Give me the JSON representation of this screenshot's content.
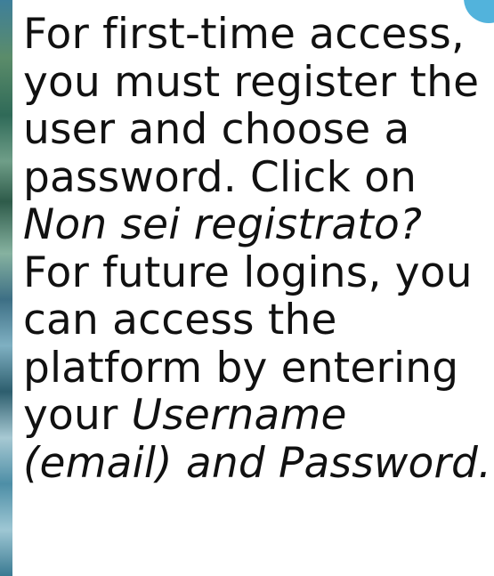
{
  "instructions": {
    "line1": "For first-time access,",
    "line2": "you must register the",
    "line3": "user and choose a",
    "line4": "password. Click on",
    "line5_italic": "Non sei registrato?",
    "line6": "For future logins, you",
    "line7": "can access the",
    "line8": "platform by entering",
    "line9_prefix": "your ",
    "line9_italic": "Username",
    "line10_italic": "(email) and Password."
  },
  "colors": {
    "corner_accent": "#52b3dc",
    "text": "#111111",
    "background": "#ffffff"
  }
}
